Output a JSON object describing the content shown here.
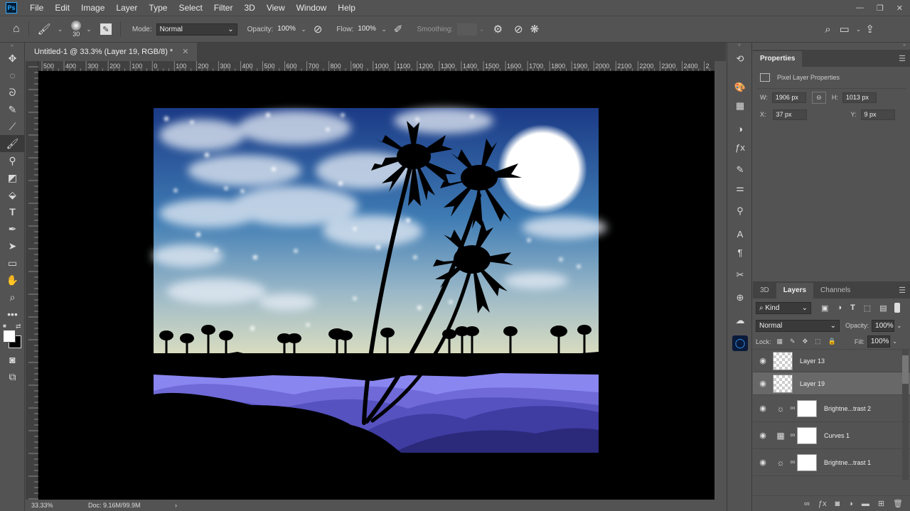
{
  "menubar": {
    "logo": "Ps",
    "items": [
      "File",
      "Edit",
      "Image",
      "Layer",
      "Type",
      "Select",
      "Filter",
      "3D",
      "View",
      "Window",
      "Help"
    ]
  },
  "options": {
    "brush_size": "30",
    "mode_label": "Mode:",
    "mode_value": "Normal",
    "opacity_label": "Opacity:",
    "opacity_value": "100%",
    "flow_label": "Flow:",
    "flow_value": "100%",
    "smoothing_label": "Smoothing:"
  },
  "document": {
    "tab_title": "Untitled-1 @ 33.3% (Layer 19, RGB/8) *",
    "zoom": "33.33%",
    "doc_info": "Doc: 9.16M/99.9M"
  },
  "ruler": {
    "h_ticks": [
      "500",
      "400",
      "300",
      "200",
      "100",
      "0",
      "100",
      "200",
      "300",
      "400",
      "500",
      "600",
      "700",
      "800",
      "900",
      "1000",
      "1100",
      "1200",
      "1300",
      "1400",
      "1500",
      "1600",
      "1700",
      "1800",
      "1900",
      "2000",
      "2100",
      "2200",
      "2300",
      "2400",
      "2"
    ]
  },
  "properties": {
    "tab": "Properties",
    "type": "Pixel Layer Properties",
    "w_label": "W:",
    "w_value": "1906 px",
    "h_label": "H:",
    "h_value": "1013 px",
    "x_label": "X:",
    "x_value": "37 px",
    "y_label": "Y:",
    "y_value": "9 px"
  },
  "layers_panel": {
    "tabs": [
      "3D",
      "Layers",
      "Channels"
    ],
    "kind": "Kind",
    "blend_mode": "Normal",
    "opacity_label": "Opacity:",
    "opacity_value": "100%",
    "lock_label": "Lock:",
    "fill_label": "Fill:",
    "fill_value": "100%",
    "layers": [
      {
        "name": "Layer 13"
      },
      {
        "name": "Layer 19"
      },
      {
        "name": "Brightne...trast 2"
      },
      {
        "name": "Curves 1"
      },
      {
        "name": "Brightne...trast 1"
      }
    ]
  },
  "colors": {
    "ui_bg": "#535353",
    "panel_dark": "#424242",
    "selected_layer": "#686868",
    "sky_top": "#1b3a86",
    "sky_bottom": "#d8dcc0",
    "water": "#8a86f0",
    "moon": "#ffffff"
  }
}
